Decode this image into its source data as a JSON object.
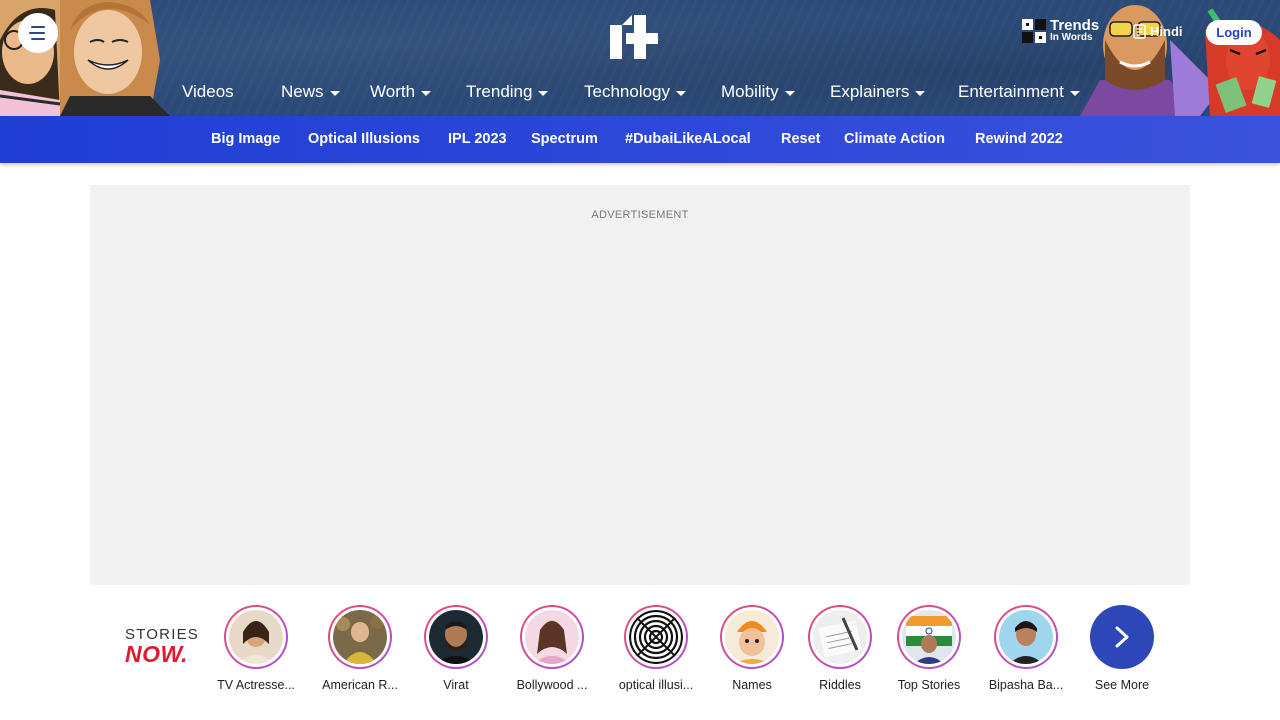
{
  "header": {
    "trends": {
      "line1": "Trends",
      "line2": "In Words"
    },
    "hindi": "Hindi",
    "login": "Login",
    "nav": [
      "Videos",
      "News",
      "Worth",
      "Trending",
      "Technology",
      "Mobility",
      "Explainers",
      "Entertainment"
    ]
  },
  "subnav": [
    "Big Image",
    "Optical Illusions",
    "IPL 2023",
    "Spectrum",
    "#DubaiLikeALocal",
    "Reset",
    "Climate Action",
    "Rewind 2022"
  ],
  "ad": {
    "label": "ADVERTISEMENT"
  },
  "stories": {
    "logo_top": "STORIES",
    "logo_bottom": "NOW.",
    "items": [
      {
        "label": "TV Actresse..."
      },
      {
        "label": "American R..."
      },
      {
        "label": "Virat"
      },
      {
        "label": "Bollywood ..."
      },
      {
        "label": "optical illusi..."
      },
      {
        "label": "Names"
      },
      {
        "label": "Riddles"
      },
      {
        "label": "Top Stories"
      },
      {
        "label": "Bipasha Ba..."
      }
    ],
    "see_more": "See More"
  },
  "colors": {
    "header_bg": "#2b4a78",
    "subnav_bg": "#2742c9",
    "accent_red": "#e01b2f",
    "see_more_bg": "#2d47b9"
  }
}
